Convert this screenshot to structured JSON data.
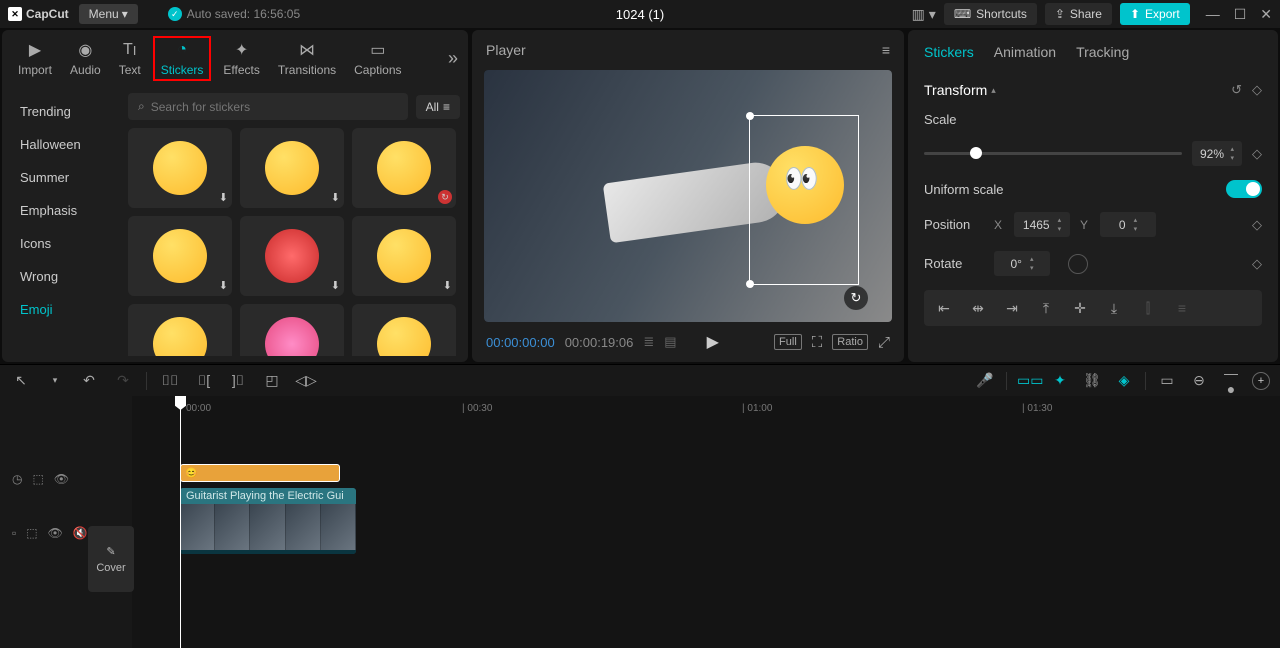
{
  "app_name": "CapCut",
  "menu_label": "Menu",
  "autosave_text": "Auto saved: 16:56:05",
  "project_title": "1024 (1)",
  "shortcuts_label": "Shortcuts",
  "share_label": "Share",
  "export_label": "Export",
  "lib_tabs": {
    "import": "Import",
    "audio": "Audio",
    "text": "Text",
    "stickers": "Stickers",
    "effects": "Effects",
    "transitions": "Transitions",
    "captions": "Captions"
  },
  "categories": [
    "Trending",
    "Halloween",
    "Summer",
    "Emphasis",
    "Icons",
    "Wrong",
    "Emoji"
  ],
  "search_placeholder": "Search for stickers",
  "all_label": "All",
  "player_label": "Player",
  "timecode_current": "00:00:00:00",
  "timecode_total": "00:00:19:06",
  "player_badges": {
    "full": "Full",
    "ratio": "Ratio"
  },
  "inspector_tabs": {
    "stickers": "Stickers",
    "animation": "Animation",
    "tracking": "Tracking"
  },
  "transform": {
    "title": "Transform",
    "scale_label": "Scale",
    "scale_value": "92%",
    "uniform_label": "Uniform scale",
    "position_label": "Position",
    "pos_x": "1465",
    "pos_y": "0",
    "rotate_label": "Rotate",
    "rotate_value": "0°"
  },
  "ruler": {
    "m0": "00:00",
    "m1": "| 00:30",
    "m2": "| 01:00",
    "m3": "| 01:30"
  },
  "cover_label": "Cover",
  "video_clip_label": "Guitarist Playing the Electric Gui"
}
